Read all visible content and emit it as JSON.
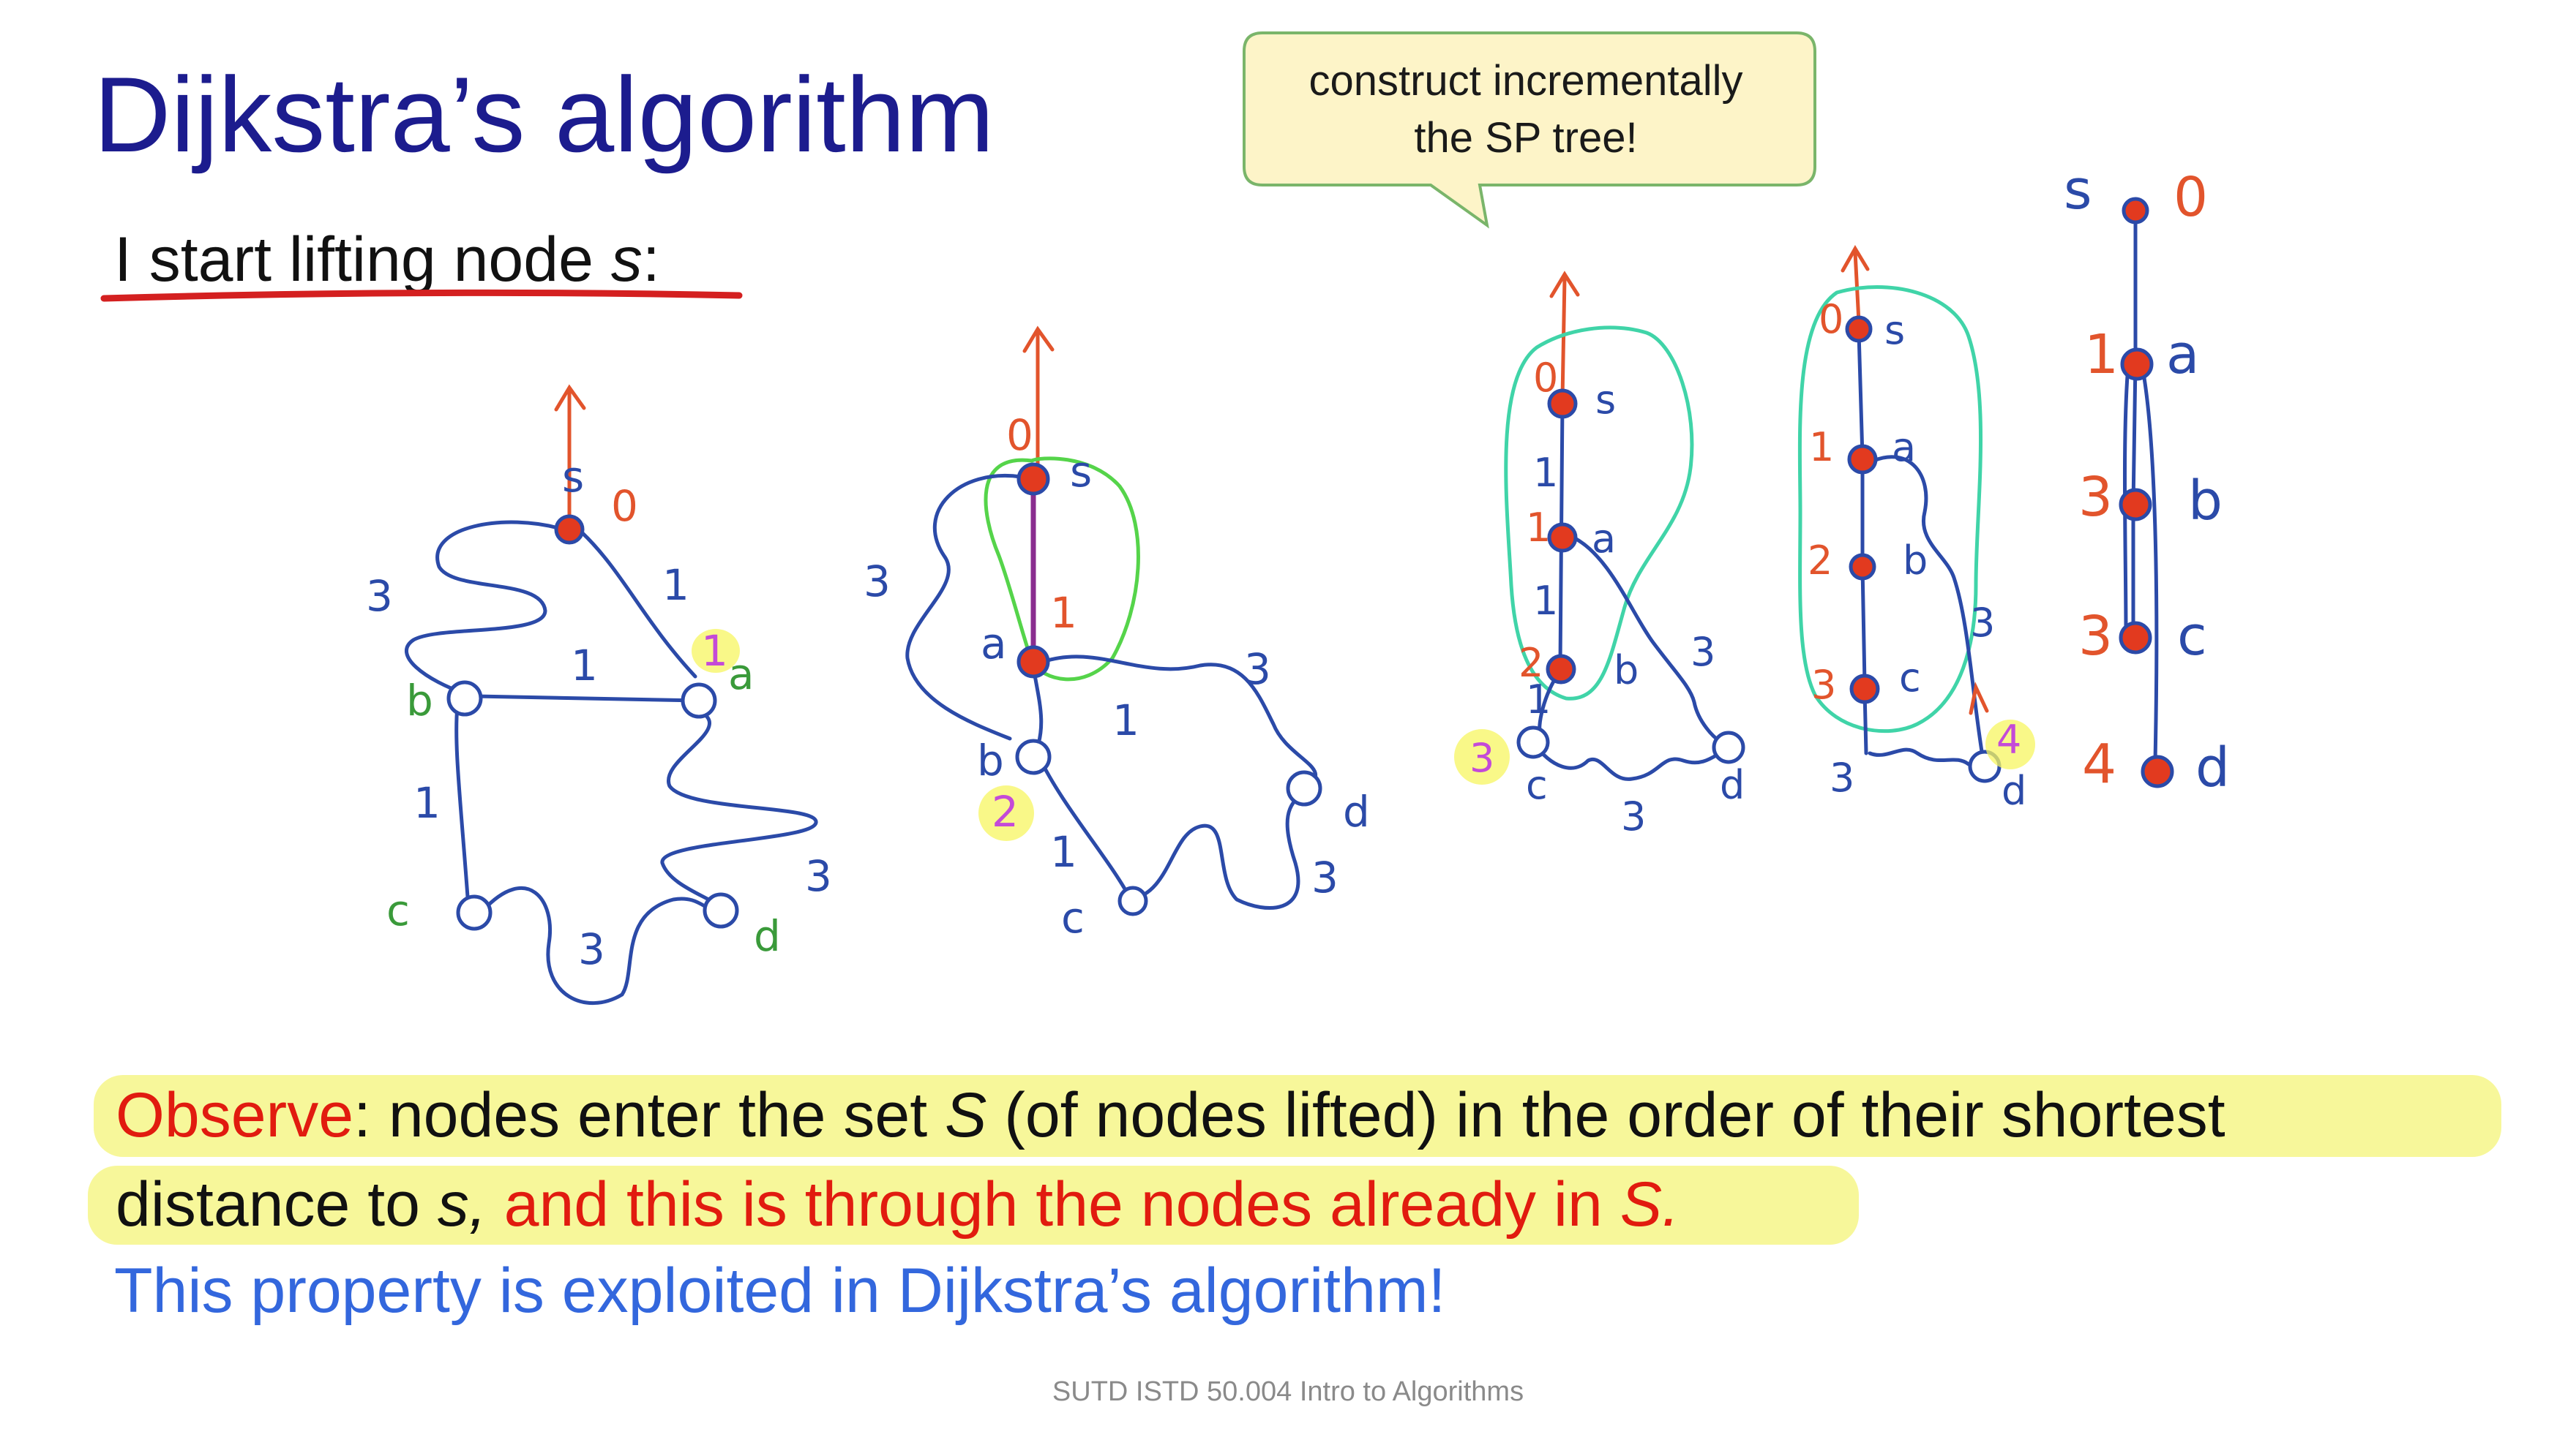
{
  "slide": {
    "title": "Dijkstra’s algorithm",
    "subtitle": {
      "text": "I start lifting node ",
      "node": "s",
      "colon": ":"
    },
    "callout": {
      "line1": "construct incrementally",
      "line2": "the SP tree!"
    },
    "observe": {
      "word": "Observe",
      "line1_rest": ": nodes enter the set ",
      "set_name": "S",
      "line1_tail": " (of nodes lifted) in the order of their shortest",
      "line2_start": "distance to ",
      "line2_s": "s,",
      "line2_red": " and this is through the nodes already in ",
      "line2_S": "S."
    },
    "property": "This property is exploited in Dijkstra’s algorithm!",
    "footer": "SUTD ISTD 50.004 Intro to Algorithms",
    "colors": {
      "title": "#1c1c8e",
      "red": "#e11b0f",
      "blue_text": "#3367dd",
      "highlight": "#f7f79a",
      "ink": "#2b4aa8",
      "green": "#3fc83f"
    }
  },
  "sketches": {
    "graph1": {
      "nodes": [
        "s",
        "a",
        "b",
        "c",
        "d"
      ],
      "dist_labels": {
        "s": "0",
        "a": "1"
      },
      "edge_weights": [
        "3",
        "1",
        "1",
        "1",
        "3",
        "3"
      ]
    },
    "graph2": {
      "nodes": [
        "s",
        "a",
        "b",
        "c",
        "d"
      ],
      "dist_labels": {
        "s": "0",
        "a": "1",
        "b": "2"
      },
      "edge_weights": [
        "3",
        "3",
        "1",
        "1",
        "3"
      ]
    },
    "graph3": {
      "nodes": [
        "s",
        "a",
        "b",
        "c",
        "d"
      ],
      "dist_labels": {
        "s": "0",
        "a": "1",
        "b": "2",
        "c": "3"
      },
      "edge_weights": [
        "1",
        "1",
        "1",
        "3",
        "3"
      ]
    },
    "graph4": {
      "nodes": [
        "s",
        "a",
        "b",
        "c",
        "d"
      ],
      "dist_labels": {
        "s": "0",
        "a": "1",
        "b": "2",
        "c": "3",
        "d": "4"
      },
      "edge_weights": [
        "3",
        "3"
      ]
    },
    "graph5": {
      "nodes": [
        "s",
        "a",
        "b",
        "c",
        "d"
      ],
      "dist_labels": {
        "s": "0",
        "a": "1",
        "b": "3",
        "c": "3",
        "d": "4"
      }
    }
  }
}
